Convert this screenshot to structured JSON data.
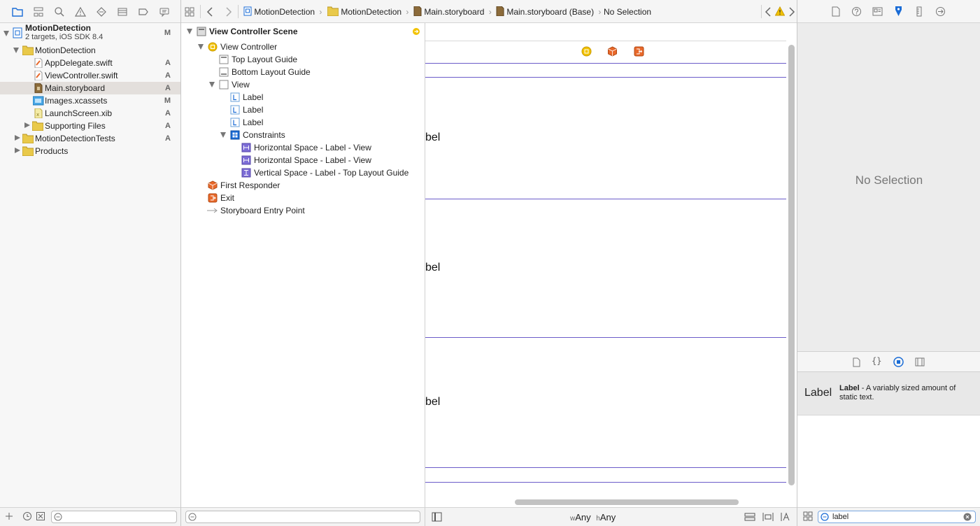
{
  "colors": {
    "accent": "#1a6cd6",
    "constraint_line": "#6b5bc9",
    "selection": "#e3dfdc",
    "warning": "#f2c200",
    "responder": "#e8682a"
  },
  "navigator": {
    "toolbar_icons": [
      "folder-icon",
      "hierarchy-icon",
      "search-icon",
      "warning-icon",
      "test-diamond-icon",
      "list-icon",
      "breakpoint-icon",
      "comment-icon"
    ],
    "project": {
      "name": "MotionDetection",
      "subtitle": "2 targets, iOS SDK 8.4",
      "status": "M"
    },
    "items": [
      {
        "label": "MotionDetection",
        "status": ""
      },
      {
        "label": "AppDelegate.swift",
        "status": "A"
      },
      {
        "label": "ViewController.swift",
        "status": "A"
      },
      {
        "label": "Main.storyboard",
        "status": "A"
      },
      {
        "label": "Images.xcassets",
        "status": "M"
      },
      {
        "label": "LaunchScreen.xib",
        "status": "A"
      },
      {
        "label": "Supporting Files",
        "status": "A"
      },
      {
        "label": "MotionDetectionTests",
        "status": "A"
      },
      {
        "label": "Products",
        "status": ""
      }
    ]
  },
  "jumpbar": {
    "crumbs": [
      "MotionDetection",
      "MotionDetection",
      "Main.storyboard",
      "Main.storyboard (Base)",
      "No Selection"
    ]
  },
  "outline": {
    "scene": "View Controller Scene",
    "items": [
      "View Controller",
      "Top Layout Guide",
      "Bottom Layout Guide",
      "View",
      "Label",
      "Label",
      "Label",
      "Constraints",
      "Horizontal Space - Label - View",
      "Horizontal Space - Label - View",
      "Vertical Space - Label - Top Layout Guide",
      "First Responder",
      "Exit",
      "Storyboard Entry Point"
    ]
  },
  "canvas": {
    "label_fragment": "bel",
    "size_class": {
      "w_prefix": "w",
      "w_value": "Any",
      "h_prefix": "h",
      "h_value": "Any"
    }
  },
  "inspector": {
    "empty_text": "No Selection"
  },
  "library": {
    "item_title": "Label",
    "item_name": "Label",
    "item_desc": " - A variably sized amount of static text.",
    "search_value": "label"
  }
}
